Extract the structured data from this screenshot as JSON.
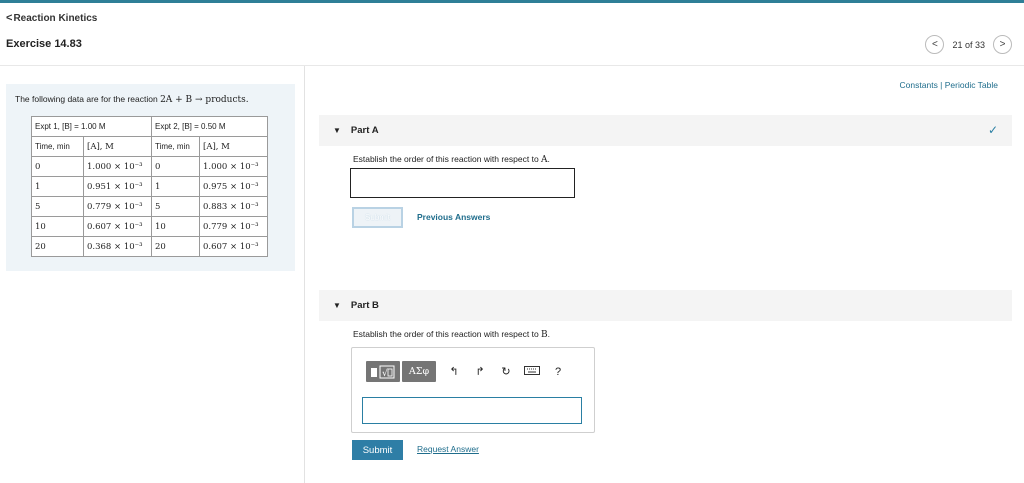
{
  "header": {
    "back_label": "Reaction Kinetics",
    "exercise_title": "Exercise 14.83",
    "pager_text": "21 of 33"
  },
  "problem": {
    "intro_text": "The following data are for the reaction ",
    "reaction": "2A + B → products.",
    "table": {
      "expt1_header": "Expt 1, [B] = 1.00 M",
      "expt2_header": "Expt 2, [B] = 0.50 M",
      "col_time": "Time, min",
      "col_conc": "[A], M",
      "rows": [
        [
          "0",
          "1.000 × 10⁻³",
          "0",
          "1.000 × 10⁻³"
        ],
        [
          "1",
          "0.951 × 10⁻³",
          "1",
          "0.975 × 10⁻³"
        ],
        [
          "5",
          "0.779 × 10⁻³",
          "5",
          "0.883 × 10⁻³"
        ],
        [
          "10",
          "0.607 × 10⁻³",
          "10",
          "0.779 × 10⁻³"
        ],
        [
          "20",
          "0.368 × 10⁻³",
          "20",
          "0.607 × 10⁻³"
        ]
      ]
    }
  },
  "links": {
    "constants": "Constants | Periodic Table"
  },
  "part_a": {
    "label": "Part A",
    "prompt_text": "Establish the order of this reaction with respect to ",
    "prompt_var": "A",
    "submit_label": "Submit",
    "previous_answers": "Previous Answers",
    "completed": true
  },
  "part_b": {
    "label": "Part B",
    "prompt_text": "Establish the order of this reaction with respect to ",
    "prompt_var": "B",
    "toolbar": {
      "greek_label": "ΑΣφ",
      "help_label": "?"
    },
    "submit_label": "Submit",
    "request_answer": "Request Answer"
  },
  "colors": {
    "accent": "#2e7ea6",
    "link": "#1f6d8c",
    "panel_bg": "#eef4f8"
  }
}
